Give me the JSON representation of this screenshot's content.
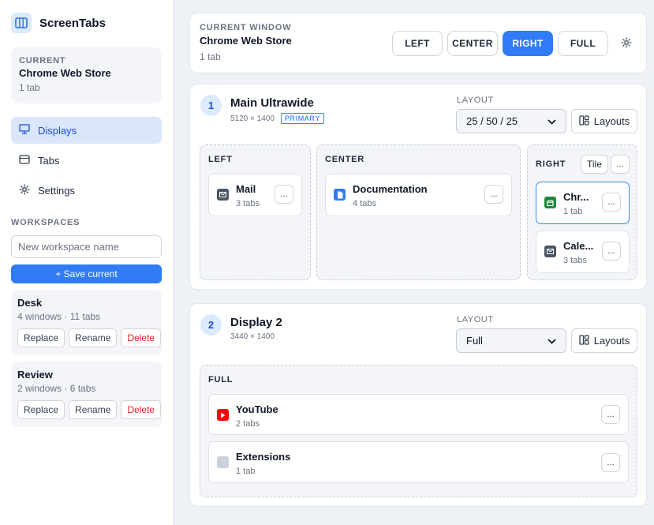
{
  "app": {
    "name": "ScreenTabs"
  },
  "sidebar": {
    "current": {
      "eyebrow": "CURRENT",
      "title": "Chrome Web Store",
      "sub": "1 tab"
    },
    "nav": [
      {
        "label": "Displays",
        "icon": "monitor-icon"
      },
      {
        "label": "Tabs",
        "icon": "window-icon"
      },
      {
        "label": "Settings",
        "icon": "gear-icon"
      }
    ],
    "workspaces_title": "WORKSPACES",
    "new_placeholder": "New workspace name",
    "save_label": "+ Save current",
    "workspaces": [
      {
        "name": "Desk",
        "meta": "4 windows · 11 tabs",
        "replace": "Replace",
        "rename": "Rename",
        "delete": "Delete"
      },
      {
        "name": "Review",
        "meta": "2 windows · 6 tabs",
        "replace": "Replace",
        "rename": "Rename",
        "delete": "Delete"
      }
    ]
  },
  "current_window": {
    "eyebrow": "CURRENT WINDOW",
    "title": "Chrome Web Store",
    "sub": "1 tab",
    "buttons": [
      "LEFT",
      "CENTER",
      "RIGHT",
      "FULL"
    ],
    "active": "RIGHT"
  },
  "displays": [
    {
      "num": "1",
      "name": "Main Ultrawide",
      "res": "5120 × 1400",
      "badge": "PRIMARY",
      "layout_label": "LAYOUT",
      "layout_value": "25 / 50 / 25",
      "layouts_btn": "Layouts",
      "zones": {
        "left": {
          "label": "LEFT",
          "cards": [
            {
              "name": "Mail",
              "sub": "3 tabs"
            }
          ]
        },
        "center": {
          "label": "CENTER",
          "cards": [
            {
              "name": "Documentation",
              "sub": "4 tabs"
            }
          ]
        },
        "right": {
          "label": "RIGHT",
          "tile": "Tile",
          "cards": [
            {
              "name": "Chr...",
              "sub": "1 tab"
            },
            {
              "name": "Cale...",
              "sub": "3 tabs"
            }
          ]
        }
      }
    },
    {
      "num": "2",
      "name": "Display 2",
      "res": "3440 × 1400",
      "layout_label": "LAYOUT",
      "layout_value": "Full",
      "layouts_btn": "Layouts",
      "zones": {
        "full": {
          "label": "FULL",
          "cards": [
            {
              "name": "YouTube",
              "sub": "2 tabs"
            },
            {
              "name": "Extensions",
              "sub": "1 tab"
            }
          ]
        }
      }
    }
  ],
  "more_label": "...",
  "colors": {
    "accent": "#2f7cf6",
    "danger": "#dc2626",
    "mail": "#4b5563",
    "docs": "#2f7cf6",
    "chrome_store": "#1f8a3e",
    "youtube": "#ff0000"
  }
}
